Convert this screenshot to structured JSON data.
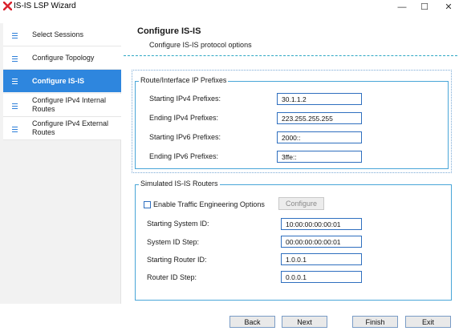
{
  "window": {
    "title": "IS-IS LSP Wizard",
    "minimize_glyph": "—",
    "maximize_glyph": "☐",
    "close_glyph": "✕"
  },
  "sidebar": {
    "items": [
      {
        "label": "Select Sessions",
        "active": false
      },
      {
        "label": "Configure Topology",
        "active": false
      },
      {
        "label": "Configure IS-IS",
        "active": true
      },
      {
        "label": "Configure IPv4 Internal Routes",
        "active": false
      },
      {
        "label": "Configure IPv4 External Routes",
        "active": false
      }
    ]
  },
  "header": {
    "title": "Configure IS-IS",
    "subtitle": "Configure IS-IS protocol options"
  },
  "prefixes": {
    "legend": "Route/Interface IP Prefixes",
    "start_ipv4_label": "Starting IPv4 Prefixes:",
    "start_ipv4_value": "30.1.1.2",
    "end_ipv4_label": "Ending IPv4 Prefixes:",
    "end_ipv4_value": "223.255.255.255",
    "start_ipv6_label": "Starting IPv6 Prefixes:",
    "start_ipv6_value": "2000::",
    "end_ipv6_label": "Ending IPv6 Prefixes:",
    "end_ipv6_value": "3ffe::"
  },
  "routers": {
    "legend": "Simulated IS-IS Routers",
    "te_checkbox_label": "Enable Traffic Engineering Options",
    "te_checked": false,
    "configure_label": "Configure",
    "start_system_id_label": "Starting System ID:",
    "start_system_id_value": "10:00:00:00:00:01",
    "system_id_step_label": "System ID Step:",
    "system_id_step_value": "00:00:00:00:00:01",
    "start_router_id_label": "Starting Router ID:",
    "start_router_id_value": "1.0.0.1",
    "router_id_step_label": "Router ID Step:",
    "router_id_step_value": "0.0.0.1"
  },
  "footer": {
    "back_label": "Back",
    "next_label": "Next",
    "finish_label": "Finish",
    "exit_label": "Exit"
  },
  "colors": {
    "accent": "#2e86de",
    "logo_red": "#d9232e",
    "input_border": "#2f6fbf",
    "group_border": "#49a6d8"
  }
}
